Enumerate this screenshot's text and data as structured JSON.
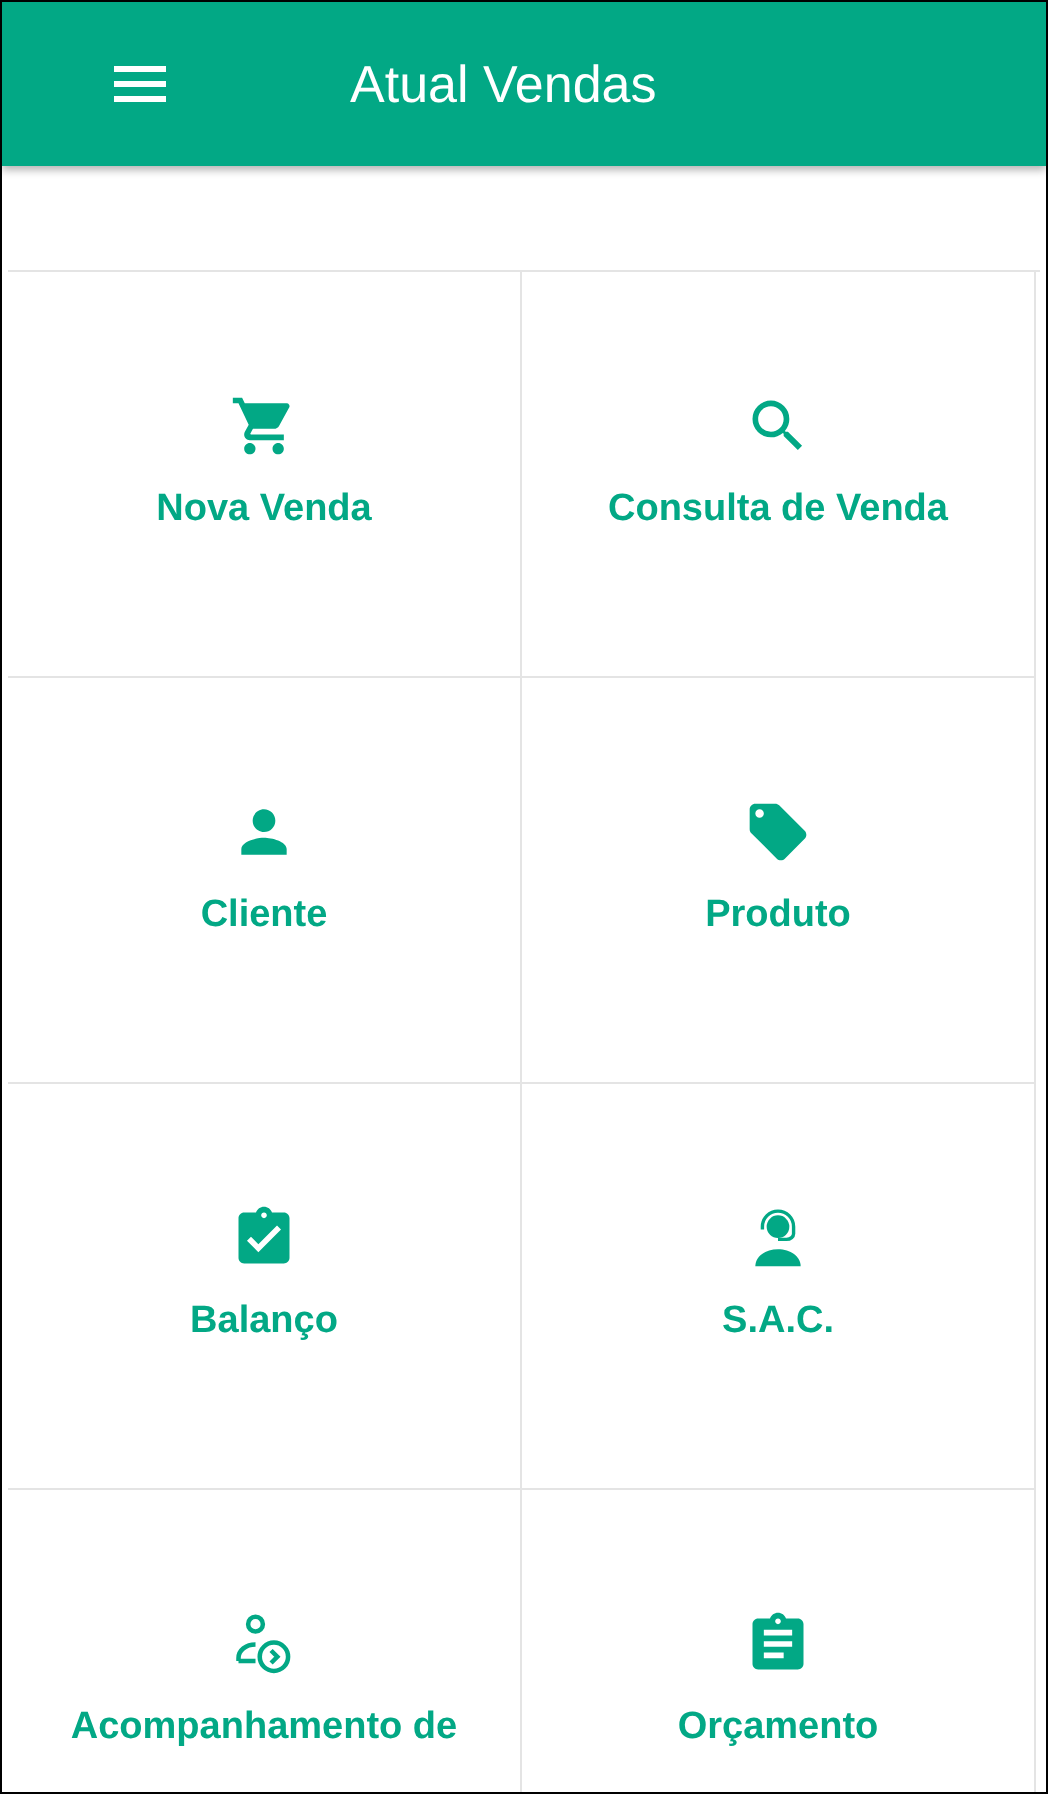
{
  "app_bar": {
    "title": "Atual Vendas"
  },
  "menu_items": [
    {
      "kind": "cart",
      "label": "Nova Venda"
    },
    {
      "kind": "search",
      "label": "Consulta de Venda"
    },
    {
      "kind": "person",
      "label": "Cliente"
    },
    {
      "kind": "tag",
      "label": "Produto"
    },
    {
      "kind": "clipboard-check",
      "label": "Balanço"
    },
    {
      "kind": "headset",
      "label": "S.A.C."
    },
    {
      "kind": "person-arrow",
      "label": "Acompanhamento de"
    },
    {
      "kind": "clipboard-list",
      "label": "Orçamento"
    }
  ]
}
